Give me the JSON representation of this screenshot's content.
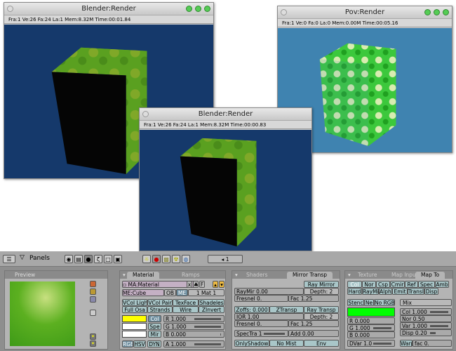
{
  "windows": [
    {
      "title": "Blender:Render",
      "info": "Fra:1  Ve:26 Fa:24 La:1 Mem:8.32M Time:00:01.84"
    },
    {
      "title": "Pov:Render",
      "info": "Fra:1  Ve:0 Fa:0 La:0 Mem:0.00M Time:00:05.16"
    },
    {
      "title": "Blender:Render",
      "info": "Fra:1  Ve:26 Fa:24 La:1 Mem:8.32M Time:00:00.83"
    }
  ],
  "header": {
    "panels_label": "Panels",
    "frame": "1"
  },
  "preview": {
    "title": "Preview"
  },
  "material": {
    "tabs": [
      "Material",
      "Ramps"
    ],
    "ma_name": "MA:Material",
    "x": "x",
    "f": "F",
    "me_name": "ME:Cube",
    "ob": "OB",
    "me": "ME",
    "mat_count": "1 Mat 1",
    "toggles": [
      "VCol Ligh",
      "VCol Pair",
      "TexFace",
      "Shadeles",
      "Full Osa",
      "Strands",
      "Wire",
      "ZInvert"
    ],
    "color_buttons": [
      "Col",
      "Spe",
      "Mir"
    ],
    "sliders": [
      "R 1.000",
      "G 1.000",
      "B 0.000",
      "A 1.000"
    ],
    "modes": [
      "RGB",
      "HSV",
      "DYN"
    ],
    "colors": {
      "col": "#ffff00",
      "spe": "#ffffff",
      "mir": "#ffffff"
    }
  },
  "shaders": {
    "tabs": [
      "Shaders",
      "Mirror Transp"
    ],
    "ray_mirror": "Ray Mirror",
    "raymir": "RayMir 0.00",
    "depth1": "Depth: 2",
    "fresnel1": "Fresnel 0.",
    "fac1": "Fac 1.25",
    "zoffs": "Zoffs: 0.000",
    "ztransp": "ZTransp",
    "ray_transp": "Ray Transp",
    "ior": "IOR 1.00",
    "depth2": "Depth: 2",
    "fresnel2": "Fresnel 0.",
    "fac2": "Fac 1.25",
    "spectra": "SpecTra 1",
    "add": "Add 0.00",
    "onlyshadow": "OnlyShadow",
    "nomist": "No Mist",
    "env": "Env"
  },
  "texture": {
    "tabs": [
      "Texture",
      "Map Input",
      "Map To"
    ],
    "mapto": [
      "Col",
      "Nor",
      "Csp",
      "Cmir",
      "Ref",
      "Spec",
      "Amb",
      "Hard",
      "RayMi",
      "Alpha",
      "Emit",
      "Translu",
      "Disp"
    ],
    "stencil": [
      "Stenc",
      "Ne",
      "No RGB"
    ],
    "blend": "Mix",
    "color": "#00ff00",
    "rgb": [
      "R 0.000",
      "G 1.000",
      "B 0.000"
    ],
    "right": [
      "Col 1.000",
      "Nor 0.50",
      "Var 1.000",
      "Disp 0.20"
    ],
    "dvar": "DVar 1.0",
    "warp": "Warp",
    "fac": "fac 0."
  }
}
